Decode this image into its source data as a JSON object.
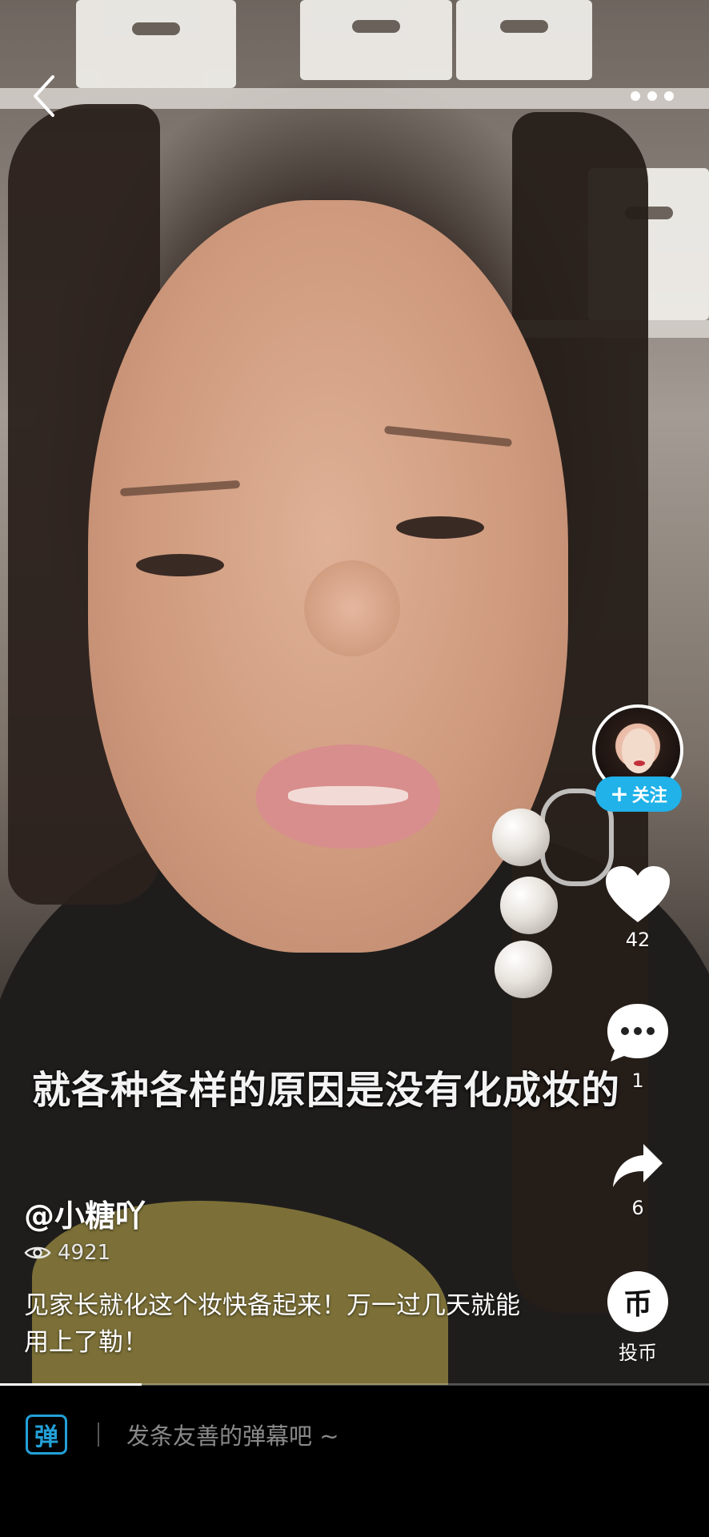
{
  "video": {
    "subtitle": "就各种各样的原因是没有化成妆的",
    "progress": 0.2
  },
  "header": {
    "back_icon": "chevron-left-icon",
    "more_icon": "more-horizontal-icon"
  },
  "creator": {
    "name": "@小糖吖",
    "follow_label": "关注",
    "follow_color": "#20b2e8"
  },
  "stats": {
    "views": "4921",
    "likes": "42",
    "comments": "1",
    "shares": "6",
    "coin_label": "投币",
    "coin_glyph": "币"
  },
  "description": "见家长就化这个妆快备起来！万一过几天就能用上了勒！",
  "bottom": {
    "danmu_toggle_glyph": "弹",
    "danmu_placeholder": "发条友善的弹幕吧 ~",
    "accent_color": "#23a0d8"
  }
}
